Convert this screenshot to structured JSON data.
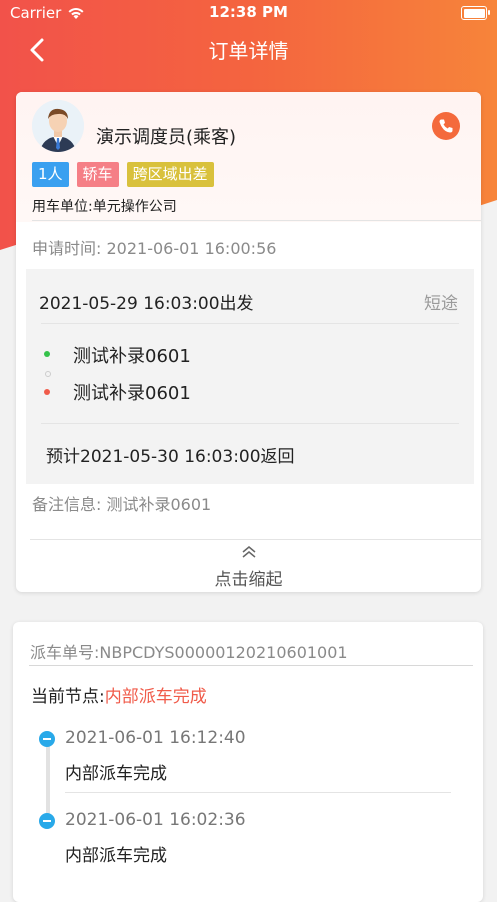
{
  "status_bar": {
    "carrier": "Carrier",
    "time": "12:38 PM"
  },
  "nav": {
    "title": "订单详情"
  },
  "order": {
    "user_name": "演示调度员(乘客)",
    "tags": [
      "1人",
      "轿车",
      "跨区域出差"
    ],
    "unit": "用车单位:单元操作公司",
    "apply_time_label": "申请时间:",
    "apply_time": "2021-06-01 16:00:56",
    "depart": "2021-05-29 16:03:00出发",
    "trip_type": "短途",
    "start_address": "测试补录0601",
    "end_address": "测试补录0601",
    "return_time": "预计2021-05-30 16:03:00返回",
    "remark": "备注信息: 测试补录0601",
    "collapse_label": "点击缩起"
  },
  "dispatch": {
    "number": "派车单号:NBPCDYS00000120210601001",
    "node_label": "当前节点:",
    "node_status": "内部派车完成",
    "timeline": [
      {
        "time": "2021-06-01 16:12:40",
        "desc": "内部派车完成"
      },
      {
        "time": "2021-06-01 16:02:36",
        "desc": "内部派车完成"
      }
    ]
  },
  "colors": {
    "header_gradient_start": "#f2524a",
    "header_gradient_end": "#f7843a",
    "accent_red": "#f05b4a",
    "timeline_blue": "#29a9e9"
  }
}
